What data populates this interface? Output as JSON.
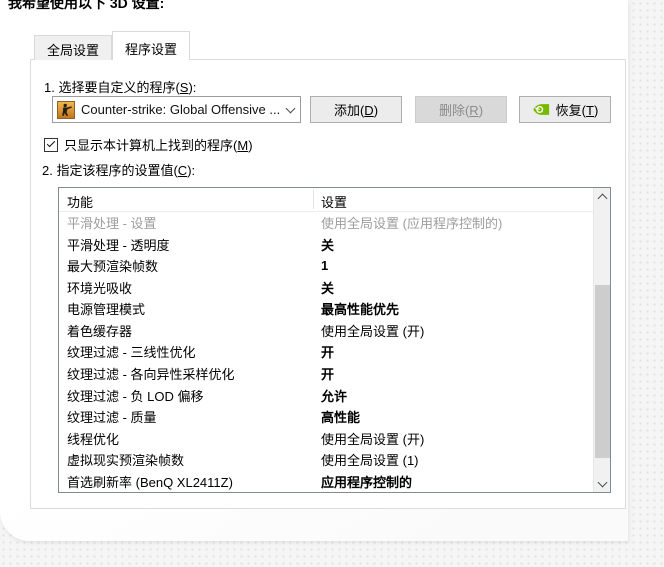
{
  "header": {
    "title": "我希望使用以下 3D 设置:"
  },
  "tabs": [
    {
      "name": "global-settings",
      "label": "全局设置",
      "active": false
    },
    {
      "name": "program-settings",
      "label": "程序设置",
      "active": true
    }
  ],
  "program_section": {
    "heading": {
      "pre": "1. 选择要自定义的程序(",
      "key": "S",
      "post": "):"
    },
    "dropdown": {
      "icon": "csgo-program-icon",
      "value": "Counter-strike: Global Offensive ...",
      "chevron": "chevron-down-icon"
    },
    "buttons": [
      {
        "name": "add-button",
        "pre": "添加(",
        "key": "D",
        "post": ")",
        "disabled": false
      },
      {
        "name": "delete-button",
        "pre": "删除(",
        "key": "R",
        "post": ")",
        "disabled": true
      },
      {
        "name": "restore-button",
        "pre": "恢复(",
        "key": "T",
        "post": ")",
        "disabled": false,
        "icon": "nvidia-logo-icon"
      }
    ],
    "show_only_checkbox": {
      "checked": true,
      "pre": "只显示本计算机上找到的程序(",
      "key": "M",
      "post": ")"
    }
  },
  "settings_section": {
    "heading": {
      "pre": "2. 指定该程序的设置值(",
      "key": "C",
      "post": "):"
    }
  },
  "settings_table": {
    "columns": [
      "功能",
      "设置"
    ],
    "rows": [
      {
        "feature": "平滑处理 - 设置",
        "value": "使用全局设置 (应用程序控制的)",
        "bold": false,
        "muted": true
      },
      {
        "feature": "平滑处理 - 透明度",
        "value": "关",
        "bold": true,
        "muted": false
      },
      {
        "feature": "最大预渲染帧数",
        "value": "1",
        "bold": true,
        "muted": false
      },
      {
        "feature": "环境光吸收",
        "value": "关",
        "bold": true,
        "muted": false
      },
      {
        "feature": "电源管理模式",
        "value": "最高性能优先",
        "bold": true,
        "muted": false
      },
      {
        "feature": "着色缓存器",
        "value": "使用全局设置 (开)",
        "bold": false,
        "muted": false
      },
      {
        "feature": "纹理过滤 - 三线性优化",
        "value": "开",
        "bold": true,
        "muted": false
      },
      {
        "feature": "纹理过滤 - 各向异性采样优化",
        "value": "开",
        "bold": true,
        "muted": false
      },
      {
        "feature": "纹理过滤 - 负 LOD 偏移",
        "value": "允许",
        "bold": true,
        "muted": false
      },
      {
        "feature": "纹理过滤 - 质量",
        "value": "高性能",
        "bold": true,
        "muted": false
      },
      {
        "feature": "线程优化",
        "value": "使用全局设置 (开)",
        "bold": false,
        "muted": false
      },
      {
        "feature": "虚拟现实预渲染帧数",
        "value": "使用全局设置 (1)",
        "bold": false,
        "muted": false
      },
      {
        "feature": "首选刷新率 (BenQ XL2411Z)",
        "value": "应用程序控制的",
        "bold": true,
        "muted": false
      }
    ]
  },
  "colors": {
    "nvidia_green": "#76b900",
    "accent_orange": "#d98a2b"
  }
}
